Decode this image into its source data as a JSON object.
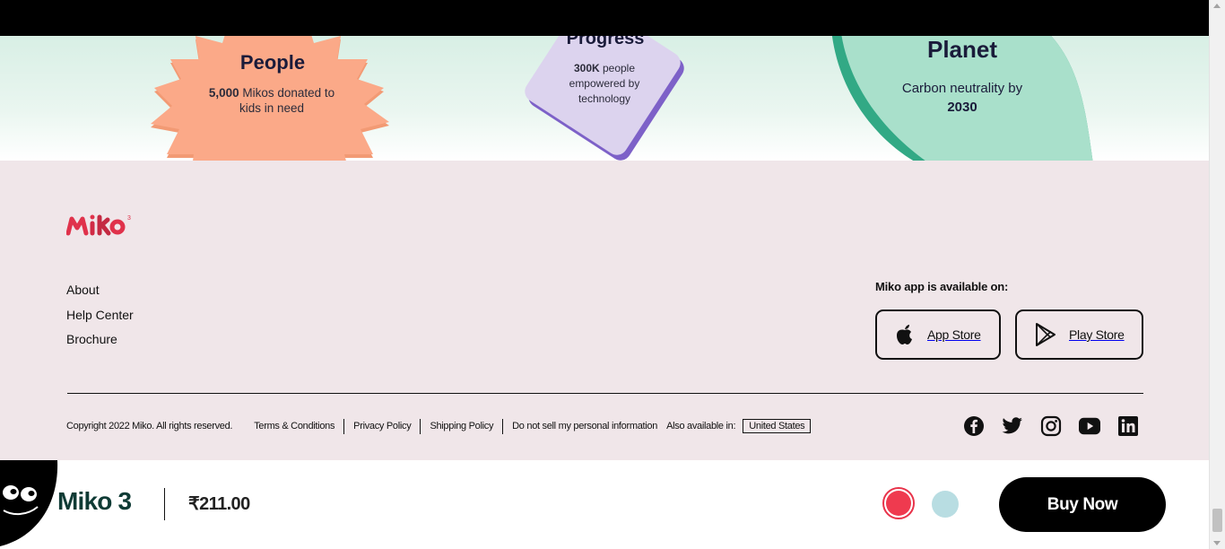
{
  "impact": {
    "people": {
      "title": "People",
      "desc_bold": "5,000",
      "desc_rest": " Mikos donated to kids in need"
    },
    "progress": {
      "title": "Progress",
      "desc_bold": "300K",
      "desc_rest": " people empowered by technology"
    },
    "planet": {
      "title": "Planet",
      "desc_line1": "Carbon neutrality by",
      "desc_bold": "2030"
    }
  },
  "footer": {
    "logo_alt": "miko3",
    "links": [
      "About",
      "Help Center",
      "Brochure"
    ],
    "app_available": "Miko app is available on:",
    "app_store": "App Store",
    "play_store": "Play Store",
    "copyright": "Copyright 2022 Miko. All rights reserved.",
    "legal_links": [
      "Terms & Conditions",
      "Privacy Policy",
      "Shipping Policy",
      "Do not sell my personal information"
    ],
    "also_available": "Also available in:",
    "region": "United States",
    "socials": [
      "facebook-icon",
      "twitter-icon",
      "instagram-icon",
      "youtube-icon",
      "linkedin-icon"
    ]
  },
  "buybar": {
    "product_name": "Miko 3",
    "price": "₹211.00",
    "colors": {
      "selected": "#ef3a4f",
      "alternate": "#b8dde2"
    },
    "buy_label": "Buy Now"
  }
}
